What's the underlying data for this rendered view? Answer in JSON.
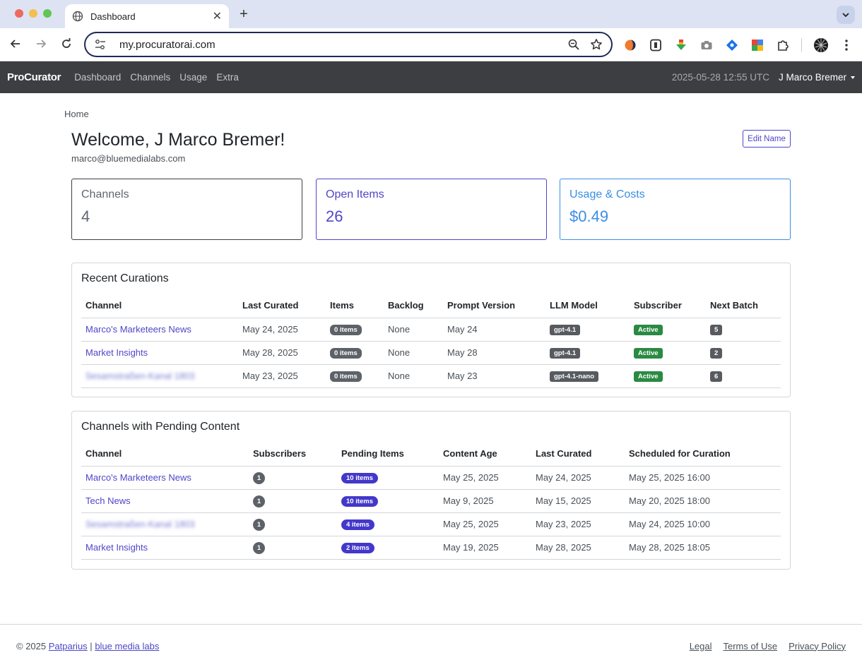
{
  "browser": {
    "tab_title": "Dashboard",
    "url": "my.procuratorai.com"
  },
  "appnav": {
    "brand": "ProCurator",
    "links": [
      "Dashboard",
      "Channels",
      "Usage",
      "Extra"
    ],
    "datetime": "2025-05-28 12:55 UTC",
    "user": "J Marco Bremer"
  },
  "breadcrumb": "Home",
  "welcome": {
    "title": "Welcome, J Marco Bremer!",
    "email": "marco@bluemedialabs.com",
    "edit_label": "Edit Name"
  },
  "stats": [
    {
      "label": "Channels",
      "value": "4",
      "color": "#5f6670"
    },
    {
      "label": "Open Items",
      "value": "26",
      "color": "#4f46c8"
    },
    {
      "label": "Usage & Costs",
      "value": "$0.49",
      "color": "#3b8ee4"
    }
  ],
  "recent": {
    "title": "Recent Curations",
    "headers": [
      "Channel",
      "Last Curated",
      "Items",
      "Backlog",
      "Prompt Version",
      "LLM Model",
      "Subscriber",
      "Next Batch"
    ],
    "rows": [
      {
        "channel": "Marco's Marketeers News",
        "last": "May 24, 2025",
        "items": "0 items",
        "backlog": "None",
        "prompt": "May 24",
        "model": "gpt-4.1",
        "subscriber": "Active",
        "next": "5"
      },
      {
        "channel": "Market Insights",
        "last": "May 28, 2025",
        "items": "0 items",
        "backlog": "None",
        "prompt": "May 28",
        "model": "gpt-4.1",
        "subscriber": "Active",
        "next": "2"
      },
      {
        "channel": "Sesamstraßen-Kanal 1803",
        "last": "May 23, 2025",
        "items": "0 items",
        "backlog": "None",
        "prompt": "May 23",
        "model": "gpt-4.1-nano",
        "subscriber": "Active",
        "next": "6"
      }
    ]
  },
  "pending": {
    "title": "Channels with Pending Content",
    "headers": [
      "Channel",
      "Subscribers",
      "Pending Items",
      "Content Age",
      "Last Curated",
      "Scheduled for Curation"
    ],
    "rows": [
      {
        "channel": "Marco's Marketeers News",
        "subs": "1",
        "pending": "10 items",
        "age": "May 25, 2025",
        "last": "May 24, 2025",
        "scheduled": "May 25, 2025 16:00"
      },
      {
        "channel": "Tech News",
        "subs": "1",
        "pending": "10 items",
        "age": "May 9, 2025",
        "last": "May 15, 2025",
        "scheduled": "May 20, 2025 18:00"
      },
      {
        "channel": "Sesamstraßen-Kanal 1803",
        "subs": "1",
        "pending": "4 items",
        "age": "May 25, 2025",
        "last": "May 23, 2025",
        "scheduled": "May 24, 2025 10:00"
      },
      {
        "channel": "Market Insights",
        "subs": "1",
        "pending": "2 items",
        "age": "May 19, 2025",
        "last": "May 28, 2025",
        "scheduled": "May 28, 2025 18:05"
      }
    ]
  },
  "footer": {
    "copyright": "© 2025",
    "company1": "Patparius",
    "sep": "|",
    "company2": "blue media labs",
    "links": [
      "Legal",
      "Terms of Use",
      "Privacy Policy"
    ]
  }
}
